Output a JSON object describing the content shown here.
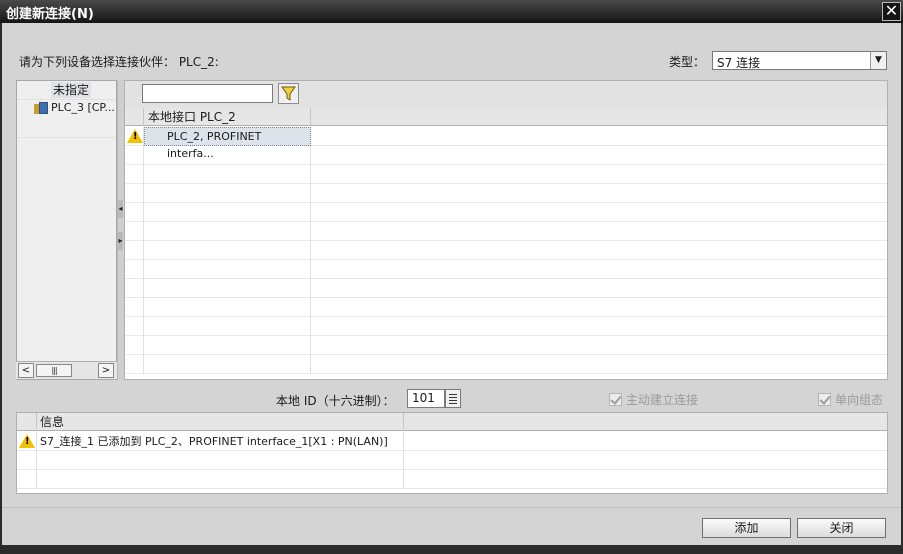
{
  "window": {
    "title": "创建新连接(N)"
  },
  "dialog": {
    "prompt": "请为下列设备选择连接伙伴：  PLC_2:",
    "type_label": "类型：",
    "type_value": "S7 连接"
  },
  "tree": {
    "items": [
      {
        "label": "未指定"
      },
      {
        "label": "PLC_3 [CP..."
      }
    ]
  },
  "table": {
    "column_header": "本地接口 PLC_2",
    "rows": [
      {
        "label": "PLC_2, PROFINET interfa...",
        "status": "warning"
      }
    ]
  },
  "local_id": {
    "label": "本地 ID（十六进制）：",
    "value": "101"
  },
  "options": {
    "active_connect": "主动建立连接",
    "oneway": "单向组态"
  },
  "info": {
    "header": "信息",
    "rows": [
      {
        "text": "S7_连接_1 已添加到 PLC_2、PROFINET interface_1[X1 : PN(LAN)]",
        "status": "warning"
      }
    ]
  },
  "buttons": {
    "add": "添加",
    "close": "关闭"
  },
  "colors": {
    "warning": "#f2c200",
    "titlebar": "#141414",
    "dialog_bg": "#d4d4d4"
  }
}
